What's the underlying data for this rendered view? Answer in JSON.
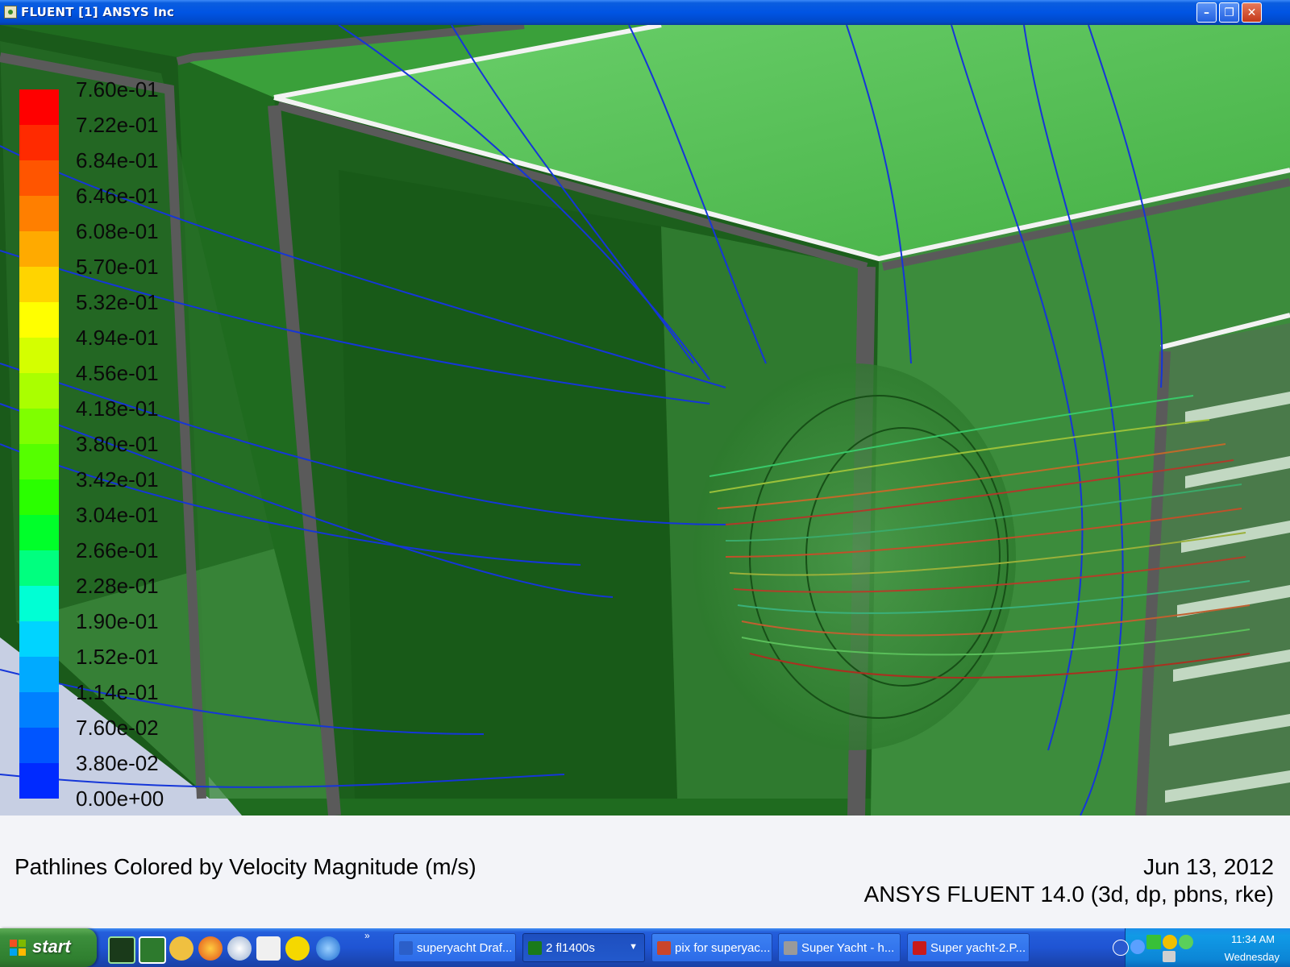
{
  "window": {
    "title": "FLUENT [1] ANSYS Inc"
  },
  "legend": {
    "labels": [
      "7.60e-01",
      "7.22e-01",
      "6.84e-01",
      "6.46e-01",
      "6.08e-01",
      "5.70e-01",
      "5.32e-01",
      "4.94e-01",
      "4.56e-01",
      "4.18e-01",
      "3.80e-01",
      "3.42e-01",
      "3.04e-01",
      "2.66e-01",
      "2.28e-01",
      "1.90e-01",
      "1.52e-01",
      "1.14e-01",
      "7.60e-02",
      "3.80e-02",
      "0.00e+00"
    ],
    "colors": [
      "#ff0000",
      "#ff2a00",
      "#ff5500",
      "#ff7f00",
      "#ffaa00",
      "#ffd400",
      "#ffff00",
      "#d4ff00",
      "#aaff00",
      "#7fff00",
      "#55ff00",
      "#2aff00",
      "#00ff2a",
      "#00ff7f",
      "#00ffd4",
      "#00d4ff",
      "#00aaff",
      "#0080ff",
      "#0055ff",
      "#002aff"
    ]
  },
  "caption": {
    "description": "Pathlines Colored by Velocity Magnitude (m/s)",
    "date": "Jun 13, 2012",
    "version": "ANSYS FLUENT 14.0 (3d, dp, pbns, rke)"
  },
  "taskbar": {
    "start_label": "start",
    "tasks": [
      {
        "label": "superyacht Draf...",
        "icon": "word-icon",
        "color": "#2b5fc9"
      },
      {
        "label": "2 fl1400s",
        "icon": "fluent-icon",
        "color": "#1a7a1a"
      },
      {
        "label": "pix for superyac...",
        "icon": "image-folder-icon",
        "color": "#c9452b"
      },
      {
        "label": "Super Yacht - h...",
        "icon": "browser-icon",
        "color": "#9a9a9a"
      },
      {
        "label": "Super yacht-2.P...",
        "icon": "pdf-icon",
        "color": "#c91a1a"
      }
    ],
    "clock": "11:34 AM",
    "day": "Wednesday"
  }
}
